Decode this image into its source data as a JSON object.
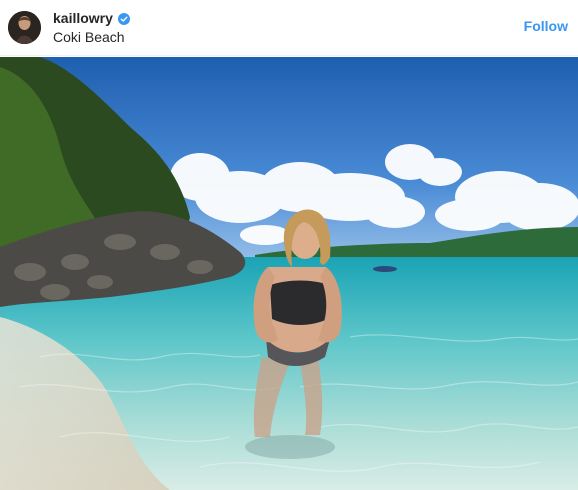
{
  "post": {
    "username": "kaillowry",
    "location": "Coki Beach",
    "follow_label": "Follow",
    "verified": true
  },
  "icons": {
    "verified": "verified-badge-icon",
    "avatar": "profile-avatar"
  },
  "colors": {
    "follow": "#3897f0",
    "verified": "#3897f0",
    "text": "#262626"
  }
}
